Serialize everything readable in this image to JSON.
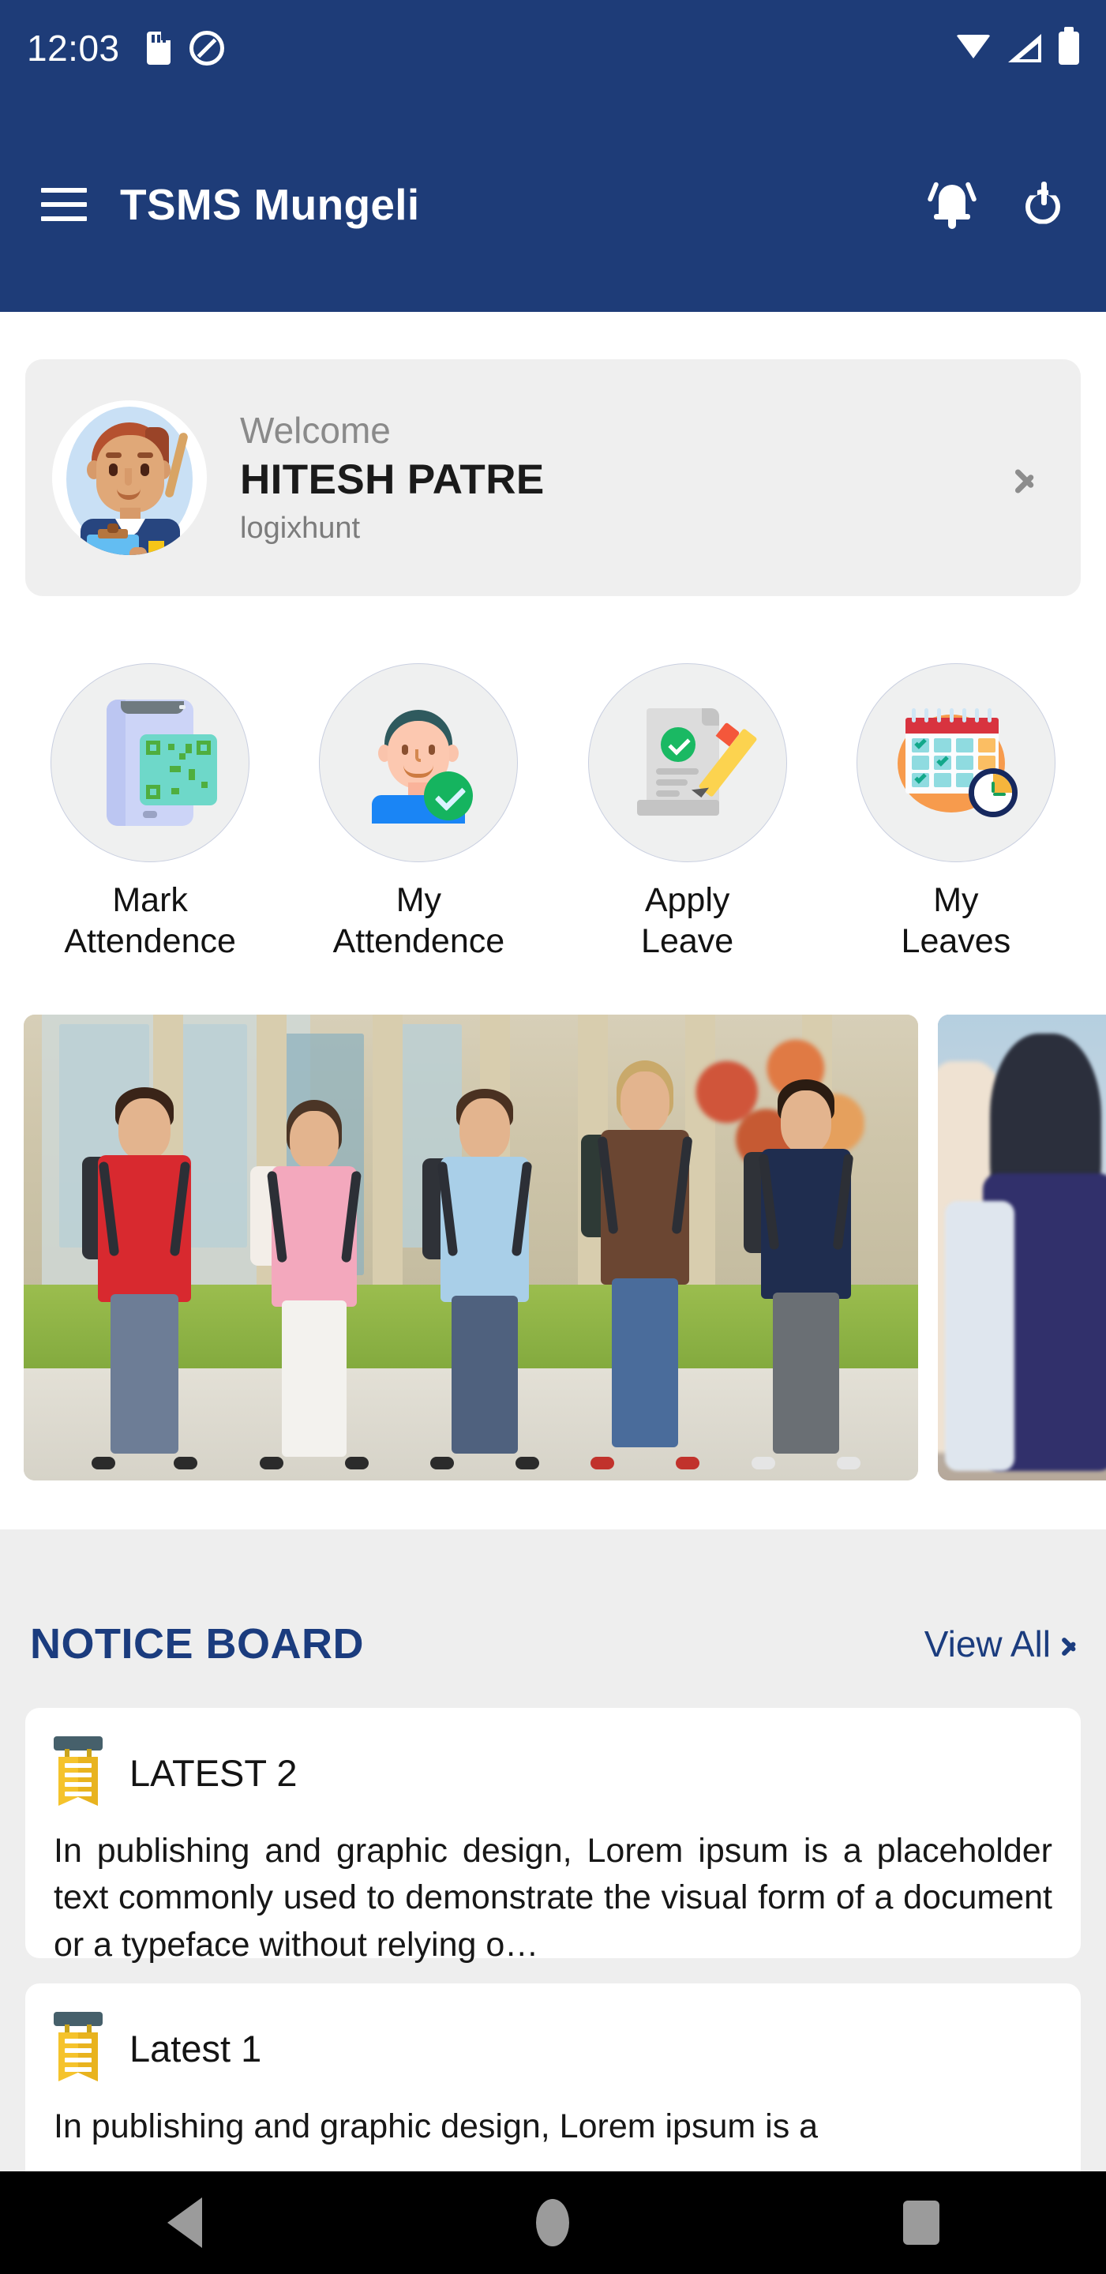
{
  "status_bar": {
    "time": "12:03",
    "left_icons": [
      "sd-card-icon",
      "do-not-disturb-icon"
    ],
    "right_icons": [
      "wifi-icon",
      "signal-icon",
      "battery-icon"
    ]
  },
  "app_bar": {
    "menu_icon": "hamburger-menu-icon",
    "title": "TSMS Mungeli",
    "notification_icon": "bell-icon",
    "power_icon": "power-icon",
    "background_color": "#1e3c78"
  },
  "welcome_card": {
    "avatar_icon": "teacher-avatar",
    "greeting": "Welcome",
    "name": "HITESH PATRE",
    "organization": "logixhunt",
    "chevron_icon": "chevron-right-icon",
    "background_color": "#efefef"
  },
  "quick_actions": [
    {
      "icon": "qr-phone-scan-icon",
      "line1": "Mark",
      "line2": "Attendence"
    },
    {
      "icon": "person-check-icon",
      "line1": "My",
      "line2": "Attendence"
    },
    {
      "icon": "document-pencil-icon",
      "line1": "Apply",
      "line2": "Leave"
    },
    {
      "icon": "calendar-clock-icon",
      "line1": "My",
      "line2": "Leaves"
    }
  ],
  "carousel": {
    "slides": [
      {
        "alt": "school-children-with-backpacks-walking"
      },
      {
        "alt": "students-in-uniform-partial"
      }
    ]
  },
  "notice_board": {
    "title": "NOTICE BOARD",
    "view_all_label": "View All",
    "view_all_icon": "chevron-right-icon",
    "accent_color": "#1b3c7e",
    "notices": [
      {
        "icon": "notice-board-icon",
        "title": "LATEST 2",
        "body": "In publishing and graphic design, Lorem ipsum is a placeholder text commonly used to demonstrate the visual form of a document or a typeface without relying o…"
      },
      {
        "icon": "notice-board-icon",
        "title": "Latest 1",
        "body": "In publishing and graphic design, Lorem ipsum is a"
      }
    ]
  },
  "nav_bar": {
    "back_icon": "back-triangle-icon",
    "home_icon": "home-circle-icon",
    "recents_icon": "recents-square-icon"
  }
}
